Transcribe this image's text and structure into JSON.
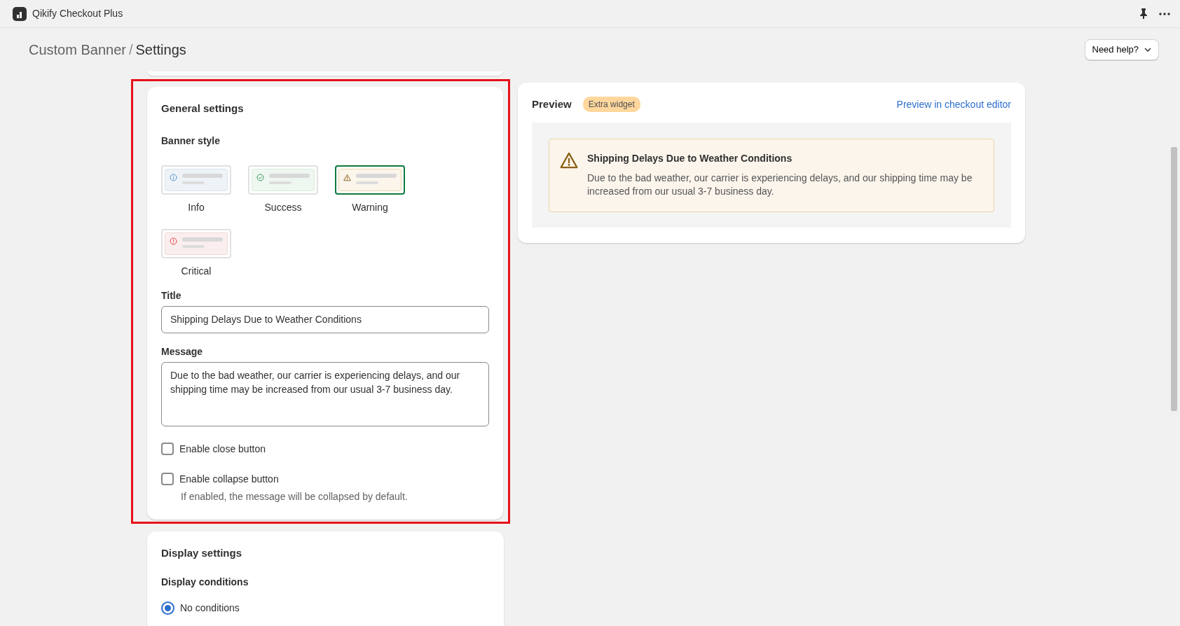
{
  "app": {
    "name": "Qikify Checkout Plus"
  },
  "header": {
    "breadcrumb": [
      "Custom Banner",
      "Settings"
    ],
    "separator": "/",
    "help_button": "Need help?"
  },
  "general": {
    "title": "General settings",
    "banner_style_label": "Banner style",
    "styles": [
      {
        "label": "Info",
        "kind": "info",
        "selected": false
      },
      {
        "label": "Success",
        "kind": "success",
        "selected": false
      },
      {
        "label": "Warning",
        "kind": "warning",
        "selected": true
      },
      {
        "label": "Critical",
        "kind": "critical",
        "selected": false
      }
    ],
    "title_field": {
      "label": "Title",
      "value": "Shipping Delays Due to Weather Conditions"
    },
    "message_field": {
      "label": "Message",
      "value": "Due to the bad weather, our carrier is experiencing delays, and our shipping time may be increased from our usual 3-7 business day."
    },
    "checkboxes": [
      {
        "label": "Enable close button",
        "checked": false
      },
      {
        "label": "Enable collapse button",
        "checked": false,
        "help": "If enabled, the message will be collapsed by default."
      }
    ]
  },
  "preview": {
    "title": "Preview",
    "badge": "Extra widget",
    "link": "Preview in checkout editor",
    "banner": {
      "kind": "warning",
      "title": "Shipping Delays Due to Weather Conditions",
      "message": "Due to the bad weather, our carrier is experiencing delays, and our shipping time may be increased from our usual 3-7 business day."
    }
  },
  "display": {
    "title": "Display settings",
    "conditions_label": "Display conditions",
    "options": [
      {
        "label": "No conditions",
        "selected": true
      }
    ]
  }
}
